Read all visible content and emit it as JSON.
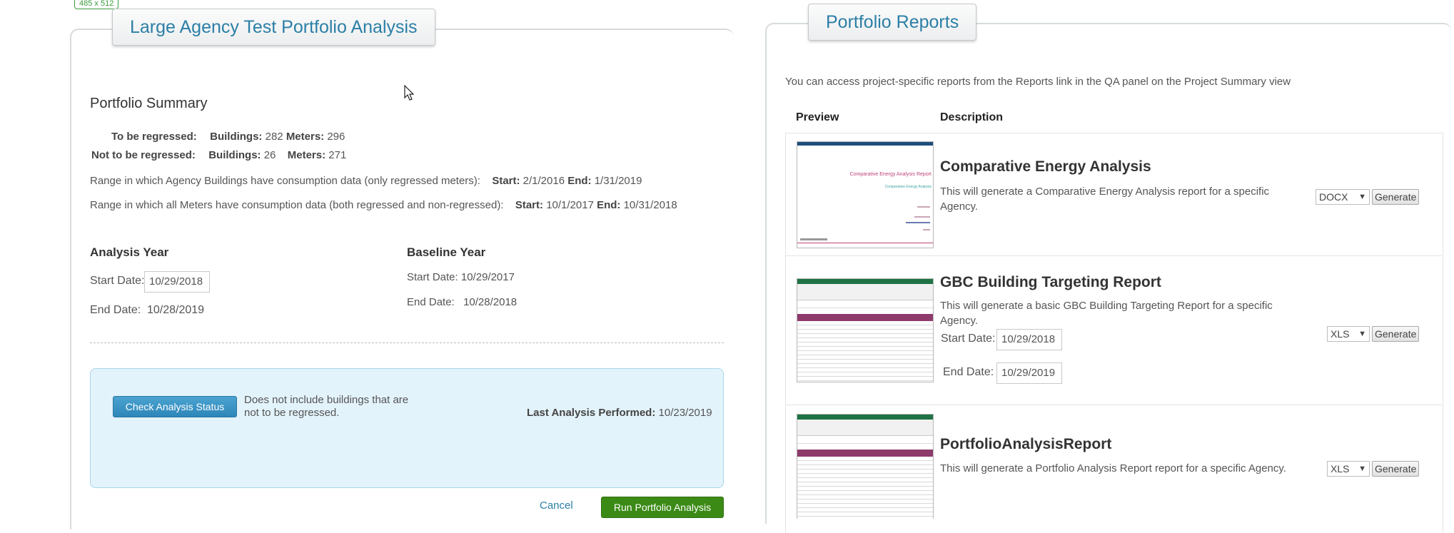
{
  "dimension_tag": "485 x 512",
  "left_panel": {
    "title": "Large Agency Test Portfolio Analysis",
    "summary_heading": "Portfolio Summary",
    "regressed": {
      "label": "To be regressed:",
      "buildings_label": "Buildings:",
      "buildings_value": "282",
      "meters_label": "Meters:",
      "meters_value": "296"
    },
    "not_regressed": {
      "label": "Not to be regressed:",
      "buildings_label": "Buildings:",
      "buildings_value": "26",
      "meters_label": "Meters:",
      "meters_value": "271"
    },
    "range_agency": {
      "text": "Range in which Agency Buildings have consumption data (only regressed meters):",
      "start_label": "Start:",
      "start_value": "2/1/2016",
      "end_label": "End:",
      "end_value": "1/31/2019"
    },
    "range_meters": {
      "text": "Range in which all Meters have consumption data (both regressed and non-regressed):",
      "start_label": "Start:",
      "start_value": "10/1/2017",
      "end_label": "End:",
      "end_value": "10/31/2018"
    },
    "analysis_year": {
      "heading": "Analysis Year",
      "start_label": "Start Date:",
      "start_value": "10/29/2018",
      "end_label": "End Date:",
      "end_value": "10/28/2019"
    },
    "baseline_year": {
      "heading": "Baseline Year",
      "start_label": "Start Date:",
      "start_value": "10/29/2017",
      "end_label": "End Date:",
      "end_value": "10/28/2018"
    },
    "status_box": {
      "button_label": "Check Analysis Status",
      "note": "Does not include buildings that are not to be regressed.",
      "last_label": "Last Analysis Performed:",
      "last_value": "10/23/2019"
    },
    "cancel_label": "Cancel",
    "run_label": "Run Portfolio Analysis"
  },
  "right_panel": {
    "title": "Portfolio Reports",
    "intro": "You can access project-specific reports from the Reports link in the QA panel on the Project Summary view",
    "columns": [
      "Preview",
      "Description"
    ],
    "reports": [
      {
        "title": "Comparative Energy Analysis",
        "description": "This will generate a Comparative Energy Analysis report for a specific Agency.",
        "format": "DOCX",
        "generate_label": "Generate",
        "thumb_type": "doc",
        "thumb_text_1": "Comparative Energy Analysis Report",
        "thumb_text_2": "Comparative Energy Analysis"
      },
      {
        "title": "GBC Building Targeting Report",
        "description": "This will generate a basic GBC Building Targeting Report for a specific Agency.",
        "format": "XLS",
        "generate_label": "Generate",
        "thumb_type": "sheet",
        "start_label": "Start Date:",
        "start_value": "10/29/2018",
        "end_label": "End Date:",
        "end_value": "10/29/2019"
      },
      {
        "title": "PortfolioAnalysisReport",
        "description": "This will generate a Portfolio Analysis Report report for a specific Agency.",
        "format": "XLS",
        "generate_label": "Generate",
        "thumb_type": "sheet"
      }
    ]
  },
  "colors": {
    "title_blue": "#2b7fa6",
    "button_blue": "#2d86b8",
    "button_green": "#3b8a16",
    "status_bg": "#e3f3fb",
    "excel_green": "#1f7244",
    "sheet_header_purple": "#8e3b6c"
  }
}
